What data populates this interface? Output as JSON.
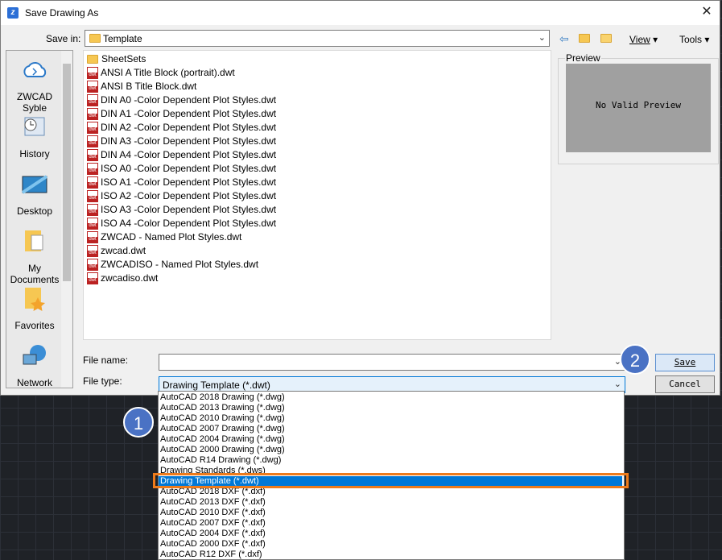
{
  "window": {
    "title": "Save Drawing As"
  },
  "save_in": {
    "label": "Save in:",
    "value": "Template"
  },
  "toolbar": {
    "view_label": "View",
    "tools_label": "Tools"
  },
  "places": [
    "ZWCAD Syble",
    "History",
    "Desktop",
    "My Documents",
    "Favorites",
    "Network"
  ],
  "files": [
    {
      "name": "SheetSets",
      "type": "folder"
    },
    {
      "name": "ANSI A Title Block (portrait).dwt",
      "type": "dwt"
    },
    {
      "name": "ANSI B Title Block.dwt",
      "type": "dwt"
    },
    {
      "name": "DIN A0 -Color Dependent Plot Styles.dwt",
      "type": "dwt"
    },
    {
      "name": "DIN A1 -Color Dependent Plot Styles.dwt",
      "type": "dwt"
    },
    {
      "name": "DIN A2 -Color Dependent Plot Styles.dwt",
      "type": "dwt"
    },
    {
      "name": "DIN A3 -Color Dependent Plot Styles.dwt",
      "type": "dwt"
    },
    {
      "name": "DIN A4 -Color Dependent Plot Styles.dwt",
      "type": "dwt"
    },
    {
      "name": "ISO A0 -Color Dependent Plot Styles.dwt",
      "type": "dwt"
    },
    {
      "name": "ISO A1 -Color Dependent Plot Styles.dwt",
      "type": "dwt"
    },
    {
      "name": "ISO A2 -Color Dependent Plot Styles.dwt",
      "type": "dwt"
    },
    {
      "name": "ISO A3 -Color Dependent Plot Styles.dwt",
      "type": "dwt"
    },
    {
      "name": "ISO A4 -Color Dependent Plot Styles.dwt",
      "type": "dwt"
    },
    {
      "name": "ZWCAD - Named Plot Styles.dwt",
      "type": "dwt"
    },
    {
      "name": "zwcad.dwt",
      "type": "dwt"
    },
    {
      "name": "ZWCADISO - Named Plot Styles.dwt",
      "type": "dwt"
    },
    {
      "name": "zwcadiso.dwt",
      "type": "dwt"
    }
  ],
  "preview": {
    "label": "Preview",
    "text": "No Valid Preview"
  },
  "file_name": {
    "label": "File name:",
    "value": ""
  },
  "file_type": {
    "label": "File type:",
    "value": "Drawing Template (*.dwt)"
  },
  "buttons": {
    "save": "Save",
    "cancel": "Cancel"
  },
  "callouts": {
    "one": "1",
    "two": "2"
  },
  "file_type_options": [
    "AutoCAD 2018 Drawing (*.dwg)",
    "AutoCAD 2013 Drawing (*.dwg)",
    "AutoCAD 2010 Drawing (*.dwg)",
    "AutoCAD 2007 Drawing (*.dwg)",
    "AutoCAD 2004 Drawing (*.dwg)",
    "AutoCAD 2000 Drawing (*.dwg)",
    "AutoCAD R14 Drawing (*.dwg)",
    "Drawing Standards (*.dws)",
    "Drawing Template (*.dwt)",
    "AutoCAD 2018 DXF (*.dxf)",
    "AutoCAD 2013 DXF (*.dxf)",
    "AutoCAD 2010 DXF (*.dxf)",
    "AutoCAD 2007 DXF (*.dxf)",
    "AutoCAD 2004 DXF (*.dxf)",
    "AutoCAD 2000 DXF (*.dxf)",
    "AutoCAD R12 DXF (*.dxf)"
  ],
  "selected_option_index": 8
}
